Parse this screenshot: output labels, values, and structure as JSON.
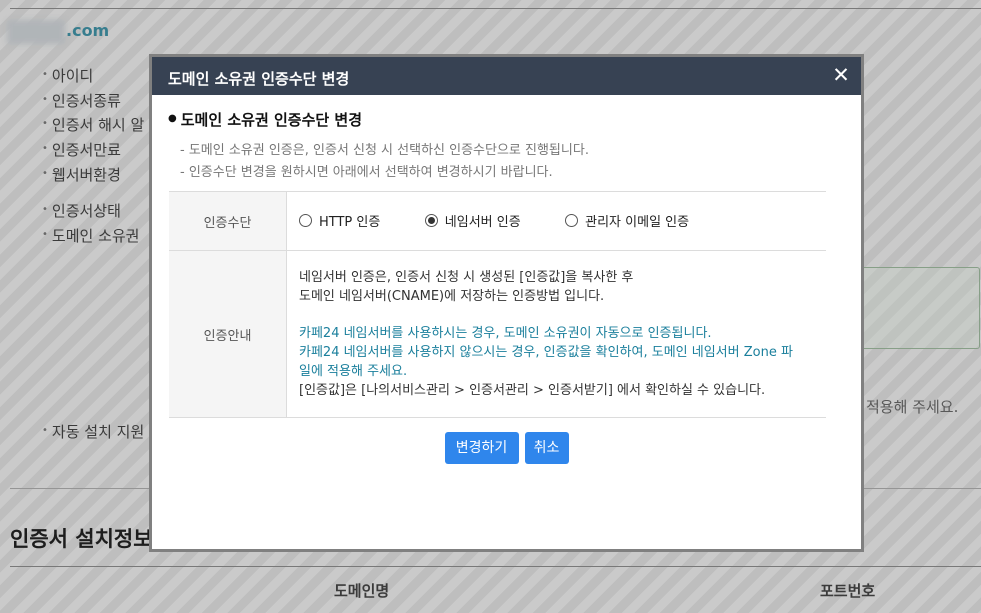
{
  "background": {
    "domain_suffix": ".com",
    "items": [
      {
        "label": "아이디"
      },
      {
        "label": "인증서종류"
      },
      {
        "label": "인증서 해시 알"
      },
      {
        "label": "인증서만료"
      },
      {
        "label": "웹서버환경"
      },
      {
        "label": "인증서상태"
      },
      {
        "label": "도메인 소유권"
      },
      {
        "label": "자동 설치 지원"
      }
    ],
    "apply_text": "적용해 주세요.",
    "section_title": "인증서 설치정보",
    "table_headers": [
      "도메인명",
      "포트번호"
    ]
  },
  "modal": {
    "title": "도메인 소유권 인증수단 변경",
    "close_icon": "✕",
    "section_title": "도메인 소유권 인증수단 변경",
    "descriptions": [
      "- 도메인 소유권 인증은, 인증서 신청 시 선택하신 인증수단으로 진행됩니다.",
      "- 인증수단 변경을 원하시면 아래에서 선택하여 변경하시기 바랍니다."
    ],
    "method_label": "인증수단",
    "methods": [
      {
        "label": "HTTP 인증",
        "checked": false
      },
      {
        "label": "네임서버 인증",
        "checked": true
      },
      {
        "label": "관리자 이메일 인증",
        "checked": false
      }
    ],
    "guide_label": "인증안내",
    "guide": {
      "line1": "네임서버 인증은, 인증서 신청 시 생성된 [인증값]을 복사한 후",
      "line2": "도메인 네임서버(CNAME)에 저장하는 인증방법 입니다.",
      "blue1": "카페24 네임서버를 사용하시는 경우, 도메인 소유권이 자동으로 인증됩니다.",
      "blue2a": "카페24 네임서버를 사용하지 않으시는 경우, 인증값을 확인하여, 도메인 네임서버 Zone 파",
      "blue2b": "일에 적용해 주세요.",
      "line3": "[인증값]은 [나의서비스관리 > 인증서관리 > 인증서받기] 에서 확인하실 수 있습니다."
    },
    "buttons": {
      "change": "변경하기",
      "cancel": "취소"
    }
  }
}
